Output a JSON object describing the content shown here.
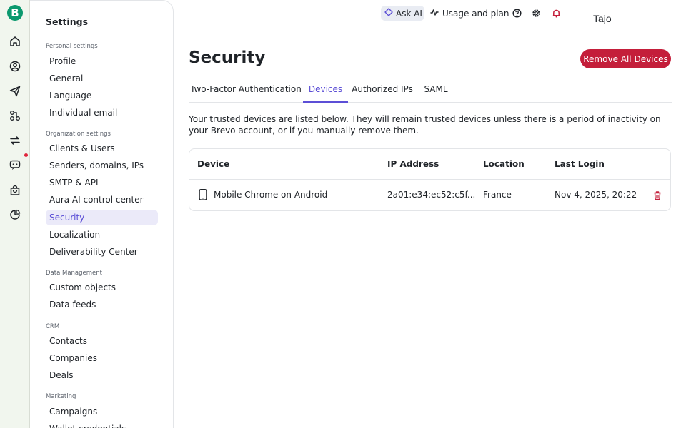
{
  "rail": {
    "logo_letter": "B",
    "icons": [
      "home-icon",
      "contacts-icon",
      "campaigns-icon",
      "automations-icon",
      "sync-icon",
      "conversations-icon",
      "ecommerce-icon",
      "reports-icon"
    ],
    "notification_color": "#e0243b"
  },
  "sidebar": {
    "title": "Settings",
    "sections": [
      {
        "label": "Personal settings",
        "items": [
          "Profile",
          "General",
          "Language",
          "Individual email"
        ]
      },
      {
        "label": "Organization settings",
        "items": [
          "Clients & Users",
          "Senders, domains, IPs",
          "SMTP & API",
          "Aura AI control center",
          "Security",
          "Localization",
          "Deliverability Center"
        ]
      },
      {
        "label": "Data Management",
        "items": [
          "Custom objects",
          "Data feeds"
        ]
      },
      {
        "label": "CRM",
        "items": [
          "Contacts",
          "Companies",
          "Deals"
        ]
      },
      {
        "label": "Marketing",
        "items": [
          "Campaigns",
          "Wallet credentials"
        ]
      }
    ],
    "active_item": "Security"
  },
  "topbar": {
    "ask_ai": "Ask AI",
    "usage": "Usage and plan",
    "icons": [
      "help-icon",
      "gear-icon",
      "bell-icon"
    ],
    "username": "Tajo"
  },
  "main": {
    "title": "Security",
    "remove_all_label": "Remove All Devices",
    "tabs": [
      "Two-Factor Authentication",
      "Devices",
      "Authorized IPs",
      "SAML"
    ],
    "active_tab": "Devices",
    "description": "Your trusted devices are listed below. They will remain trusted devices unless there is a period of inactivity on your Brevo account, or if you manually remove them.",
    "table": {
      "headers": [
        "Device",
        "IP Address",
        "Location",
        "Last Login"
      ],
      "rows": [
        {
          "device": "Mobile Chrome on Android",
          "ip": "2a01:e34:ec52:c5f...",
          "location": "France",
          "last_login": "Nov 4, 2025, 20:22"
        }
      ]
    }
  },
  "colors": {
    "brand": "#0b996e",
    "accent": "#5c4fd6",
    "danger": "#c41e3a",
    "active_item_bg": "#ebeaf9"
  }
}
